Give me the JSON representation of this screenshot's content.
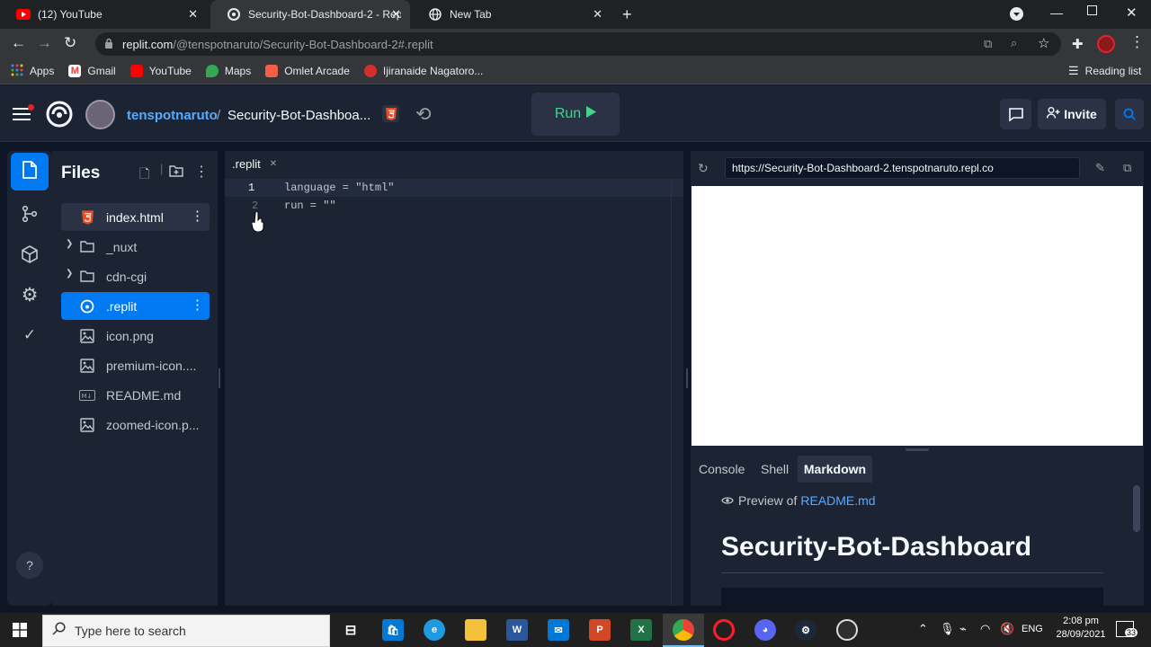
{
  "browser": {
    "tabs": [
      {
        "title": "(12) YouTube",
        "active": false
      },
      {
        "title": "Security-Bot-Dashboard-2 - Repl",
        "active": true
      },
      {
        "title": "New Tab",
        "active": false
      }
    ],
    "url_host": "replit.com",
    "url_path": "/@tenspotnaruto/Security-Bot-Dashboard-2#.replit",
    "bookmarks": [
      "Apps",
      "Gmail",
      "YouTube",
      "Maps",
      "Omlet Arcade",
      "Ijiranaide Nagatoro..."
    ],
    "reading_list": "Reading list"
  },
  "header": {
    "username": "tenspotnaruto",
    "separator": "/",
    "repl_name": "Security-Bot-Dashboa...",
    "run_label": "Run",
    "invite_label": "Invite"
  },
  "files": {
    "title": "Files",
    "items": [
      {
        "name": "index.html",
        "icon": "html5-icon"
      },
      {
        "name": "_nuxt",
        "icon": "folder-icon"
      },
      {
        "name": "cdn-cgi",
        "icon": "folder-icon"
      },
      {
        "name": ".replit",
        "icon": "replit-icon"
      },
      {
        "name": "icon.png",
        "icon": "image-icon"
      },
      {
        "name": "premium-icon....",
        "icon": "image-icon"
      },
      {
        "name": "README.md",
        "icon": "markdown-icon"
      },
      {
        "name": "zoomed-icon.p...",
        "icon": "image-icon"
      }
    ]
  },
  "editor": {
    "tab_label": ".replit",
    "lines": [
      {
        "num": "1",
        "code": "language = \"html\""
      },
      {
        "num": "2",
        "code": "run = \"\""
      }
    ]
  },
  "webview": {
    "url": "https://Security-Bot-Dashboard-2.tenspotnaruto.repl.co"
  },
  "console": {
    "tabs": [
      "Console",
      "Shell",
      "Markdown"
    ],
    "active_tab": "Markdown",
    "preview_prefix": "Preview of",
    "preview_file": "README.md",
    "heading": "Security-Bot-Dashboard"
  },
  "help_label": "?",
  "taskbar": {
    "search_placeholder": "Type here to search",
    "language": "ENG",
    "time": "2:08 pm",
    "date": "28/09/2021",
    "notifications": "33"
  },
  "colors": {
    "accent": "#0079f2",
    "run_green": "#3dd68c",
    "link": "#57abff",
    "bg": "#0e1525",
    "panel": "#1c2333"
  }
}
